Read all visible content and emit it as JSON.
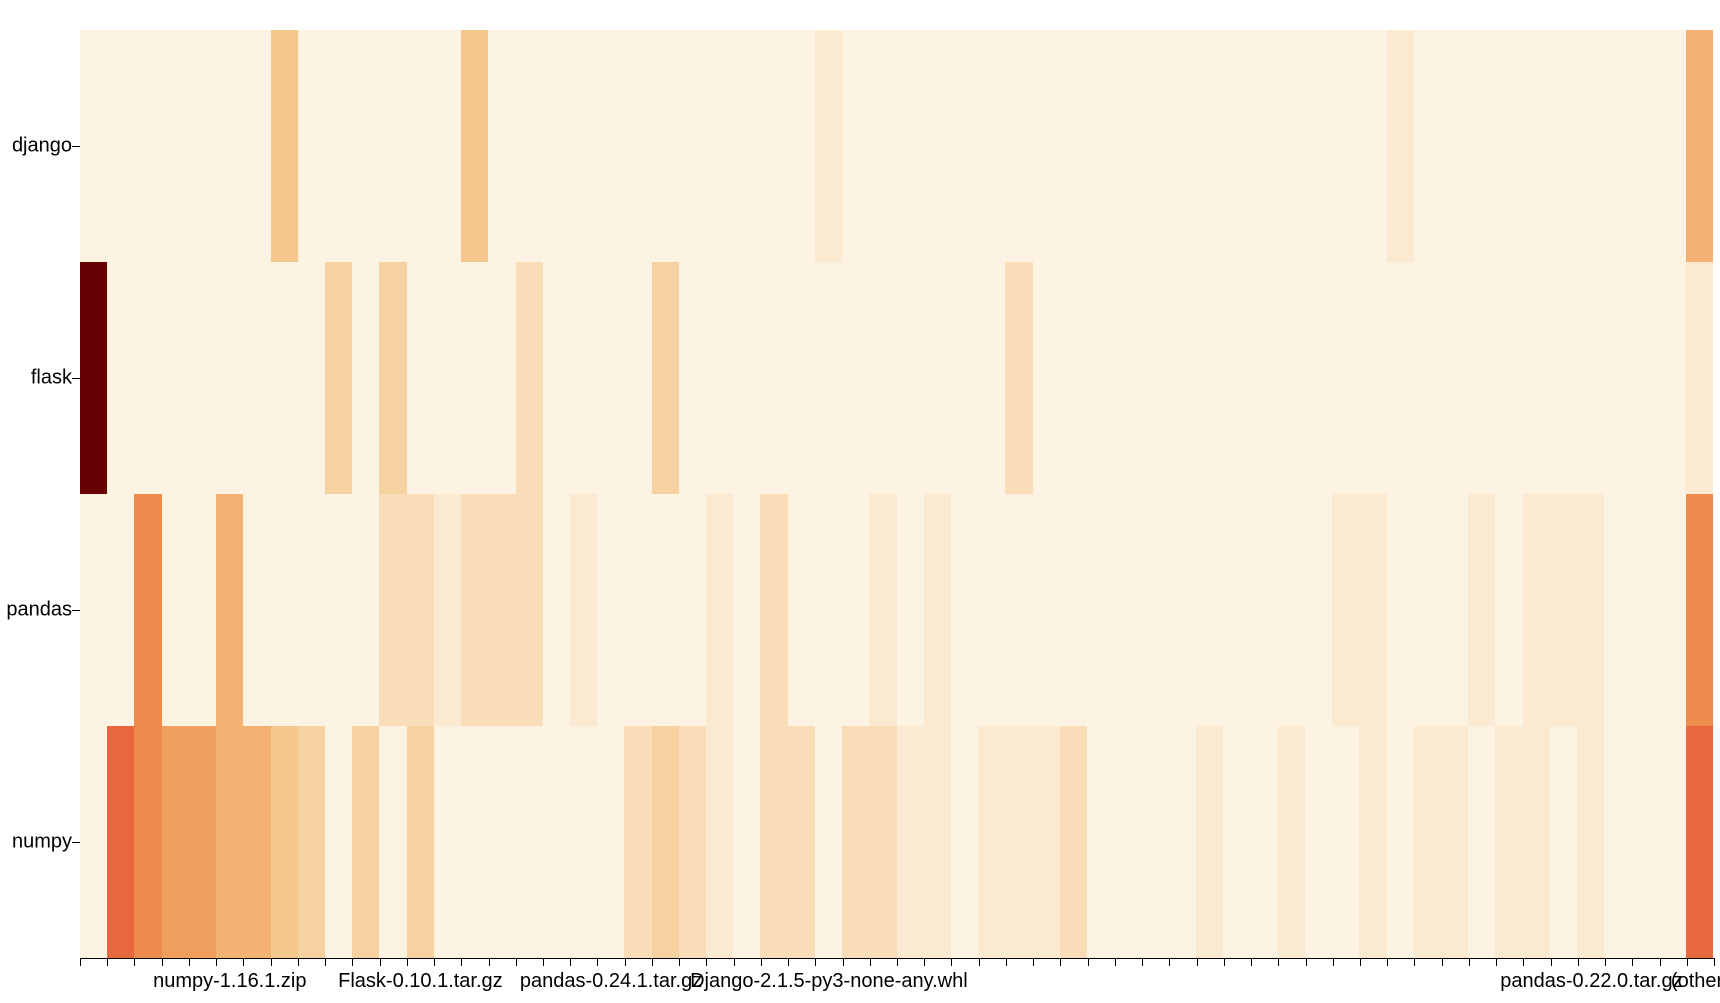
{
  "chart_data": {
    "type": "heatmap",
    "y_categories": [
      "django",
      "flask",
      "pandas",
      "numpy"
    ],
    "x_tick_labels": [
      {
        "index": 5,
        "label": "numpy-1.16.1.zip"
      },
      {
        "index": 12,
        "label": "Flask-0.10.1.tar.gz"
      },
      {
        "index": 19,
        "label": "pandas-0.24.1.tar.gz"
      },
      {
        "index": 27,
        "label": "Django-2.1.5-py3-none-any.whl"
      },
      {
        "index": 55,
        "label": "pandas-0.22.0.tar.gz"
      },
      {
        "index": 59,
        "label": "(other)"
      }
    ],
    "colorscale_note": "OrRd-like: 0=cream, higher=orange/red/darkred",
    "n_columns": 60,
    "matrix": {
      "django": [
        0,
        0,
        0,
        0,
        0,
        0,
        0,
        2.5,
        0,
        0,
        0,
        0,
        0,
        0,
        2.5,
        0,
        0,
        0,
        0,
        0,
        0,
        0,
        0,
        0,
        0,
        0,
        0,
        1,
        0,
        0,
        0,
        0,
        0,
        0,
        0,
        0,
        0,
        0,
        0,
        0,
        0,
        0,
        0,
        0,
        0,
        0,
        0,
        0,
        1,
        0,
        0,
        0,
        0,
        0,
        0,
        0,
        0,
        0,
        0,
        3
      ],
      "flask": [
        10,
        0,
        0,
        0,
        0,
        0,
        0,
        0,
        0,
        2,
        0,
        2,
        0,
        0,
        0,
        0,
        1.5,
        0,
        0,
        0,
        0,
        2,
        0,
        0,
        0,
        0,
        0,
        0,
        0,
        0,
        0,
        0,
        0,
        0,
        1.5,
        0,
        0,
        0,
        0,
        0,
        0,
        0,
        0,
        0,
        0,
        0,
        0,
        0,
        0,
        0,
        0,
        0,
        0,
        0,
        0,
        0,
        0,
        0,
        0,
        1
      ],
      "pandas": [
        0,
        0,
        4,
        0,
        0,
        3,
        0,
        0,
        0,
        0,
        0,
        1.5,
        1.5,
        1,
        1.5,
        1.5,
        1.5,
        0,
        1,
        0,
        0,
        0,
        0,
        1,
        0,
        1.5,
        0,
        0,
        0,
        1,
        0,
        1,
        0,
        0,
        0,
        0,
        0,
        0,
        0,
        0,
        0,
        0,
        0,
        0,
        0,
        0,
        1,
        1,
        0,
        0,
        0,
        1,
        0,
        1,
        1,
        1,
        0,
        0,
        0,
        4
      ],
      "numpy": [
        0,
        5,
        4,
        3.5,
        3.5,
        3,
        3,
        2.5,
        2,
        0,
        2,
        0,
        2,
        0,
        0,
        0,
        0,
        0,
        0,
        0,
        1.5,
        2,
        1.5,
        1,
        0,
        1.5,
        1.5,
        0,
        1.5,
        1.5,
        1,
        1,
        0,
        1,
        1,
        1,
        1.5,
        0,
        0,
        0,
        0,
        1,
        0,
        0,
        1,
        0,
        0,
        1,
        0,
        1,
        1,
        0,
        1,
        1,
        0,
        1,
        0,
        0,
        0,
        5
      ]
    },
    "value_to_color": [
      {
        "v": 0,
        "c": "#fdf3e3"
      },
      {
        "v": 1,
        "c": "#fbe9d1"
      },
      {
        "v": 1.5,
        "c": "#f8ddb8"
      },
      {
        "v": 2,
        "c": "#f7d2a1"
      },
      {
        "v": 2.5,
        "c": "#f6c78c"
      },
      {
        "v": 3,
        "c": "#f3b271"
      },
      {
        "v": 3.5,
        "c": "#f19f5e"
      },
      {
        "v": 4,
        "c": "#ee8c4e"
      },
      {
        "v": 5,
        "c": "#e8673c"
      },
      {
        "v": 10,
        "c": "#670005"
      }
    ]
  }
}
